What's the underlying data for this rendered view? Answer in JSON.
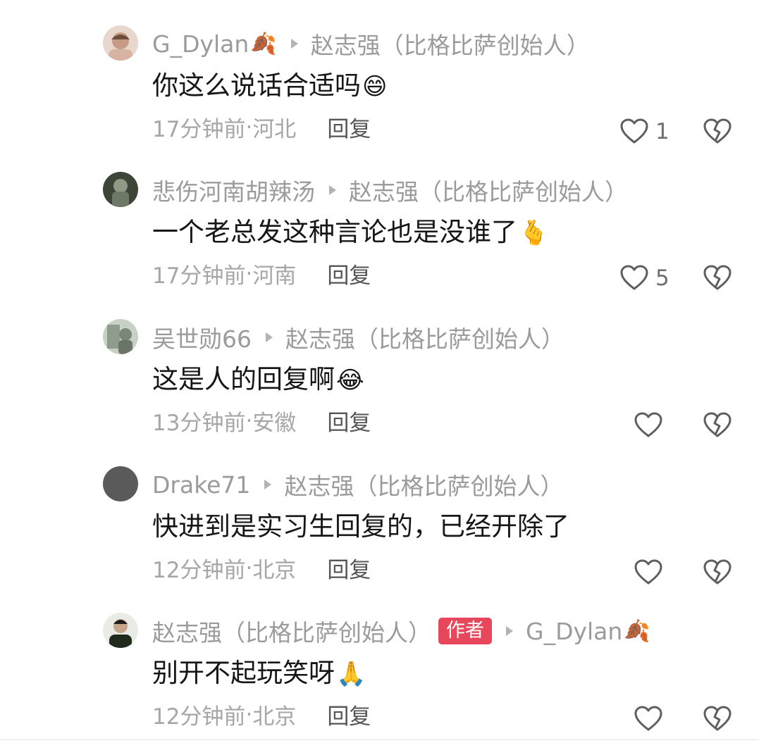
{
  "comments": [
    {
      "username": "G_Dylan",
      "username_emoji": "🍂",
      "is_author": false,
      "reply_to": "赵志强（比格比萨创始人）",
      "reply_to_emoji": "",
      "text": "你这么说话合适吗",
      "text_emoji": "😄",
      "time": "17分钟前",
      "location": "河北",
      "likes": "1",
      "avatar_color": "#c79a86"
    },
    {
      "username": "悲伤河南胡辣汤",
      "username_emoji": "",
      "is_author": false,
      "reply_to": "赵志强（比格比萨创始人）",
      "reply_to_emoji": "",
      "text": "一个老总发这种言论也是没谁了",
      "text_emoji": "🫰",
      "time": "17分钟前",
      "location": "河南",
      "likes": "5",
      "avatar_color": "#5e6a57"
    },
    {
      "username": "吴世勋66",
      "username_emoji": "",
      "is_author": false,
      "reply_to": "赵志强（比格比萨创始人）",
      "reply_to_emoji": "",
      "text": "这是人的回复啊",
      "text_emoji": "😂",
      "time": "13分钟前",
      "location": "安徽",
      "likes": "",
      "avatar_color": "#9aa79a"
    },
    {
      "username": "Drake71",
      "username_emoji": "",
      "is_author": false,
      "reply_to": "赵志强（比格比萨创始人）",
      "reply_to_emoji": "",
      "text": "快进到是实习生回复的，已经开除了",
      "text_emoji": "",
      "time": "12分钟前",
      "location": "北京",
      "likes": "",
      "avatar_color": "#5a5a5a"
    },
    {
      "username": "赵志强（比格比萨创始人）",
      "username_emoji": "",
      "is_author": true,
      "reply_to": "G_Dylan",
      "reply_to_emoji": "🍂",
      "text": "别开不起玩笑呀",
      "text_emoji": "🙏",
      "time": "12分钟前",
      "location": "北京",
      "likes": "",
      "avatar_color": "#2f3a2b"
    }
  ],
  "labels": {
    "author_badge": "作者",
    "reply": "回复",
    "separator": " · "
  },
  "icons": {
    "like": "heart-outline-icon",
    "dislike": "broken-heart-icon"
  }
}
